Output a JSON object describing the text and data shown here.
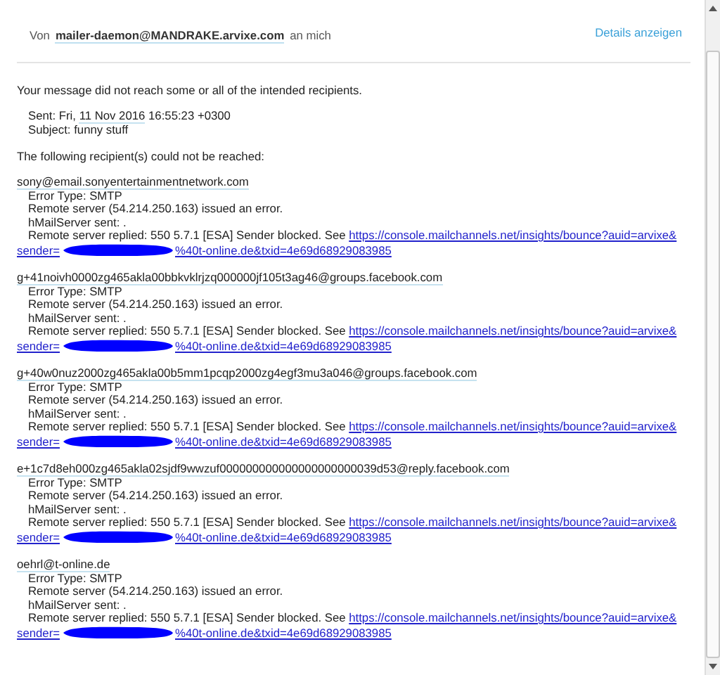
{
  "header": {
    "from_label": "Von",
    "sender": "mailer-daemon@MANDRAKE.arvixe.com",
    "to": "an mich",
    "details_link": "Details anzeigen"
  },
  "intro": "Your message did not reach some or all of the intended recipients.",
  "sent": {
    "label": "Sent: Fri,",
    "date": "11 Nov 2016",
    "time": "16:55:23 +0300"
  },
  "subject": "Subject: funny stuff",
  "failed_heading": "The following recipient(s) could not be reached:",
  "recipients": [
    {
      "address": "sony@email.sonyentertainmentnetwork.com",
      "error_type": "Error Type: SMTP",
      "remote_error": "Remote server (54.214.250.163) issued an error.",
      "hmail_sent": "hMailServer sent: .",
      "reply": "Remote server replied: 550 5.7.1 [ESA] Sender blocked. See",
      "link_start": "https://console.mailchannels.net/insights/bounce?auid=arvixe&",
      "link_prefix": "sender=",
      "link_end": "%40t-online.de&txid=4e69d68929083985"
    },
    {
      "address": "g+41noivh0000zg465akla00bbkvklrjzq000000jf105t3ag46@groups.facebook.com",
      "error_type": "Error Type: SMTP",
      "remote_error": "Remote server (54.214.250.163) issued an error.",
      "hmail_sent": "hMailServer sent: .",
      "reply": "Remote server replied: 550 5.7.1 [ESA] Sender blocked. See",
      "link_start": "https://console.mailchannels.net/insights/bounce?auid=arvixe&",
      "link_prefix": "sender=",
      "link_end": "%40t-online.de&txid=4e69d68929083985"
    },
    {
      "address": "g+40w0nuz2000zg465akla00b5mm1pcqp2000zg4egf3mu3a046@groups.facebook.com",
      "error_type": "Error Type: SMTP",
      "remote_error": "Remote server (54.214.250.163) issued an error.",
      "hmail_sent": "hMailServer sent: .",
      "reply": "Remote server replied: 550 5.7.1 [ESA] Sender blocked. See",
      "link_start": "https://console.mailchannels.net/insights/bounce?auid=arvixe&",
      "link_prefix": "sender=",
      "link_end": "%40t-online.de&txid=4e69d68929083985"
    },
    {
      "address": "e+1c7d8eh000zg465akla02sjdf9wwzuf000000000000000000000039d53@reply.facebook.com",
      "error_type": "Error Type: SMTP",
      "remote_error": "Remote server (54.214.250.163) issued an error.",
      "hmail_sent": "hMailServer sent: .",
      "reply": "Remote server replied: 550 5.7.1 [ESA] Sender blocked. See",
      "link_start": "https://console.mailchannels.net/insights/bounce?auid=arvixe&",
      "link_prefix": "sender=",
      "link_end": "%40t-online.de&txid=4e69d68929083985"
    },
    {
      "address": "oehrl@t-online.de",
      "error_type": "Error Type: SMTP",
      "remote_error": "Remote server (54.214.250.163) issued an error.",
      "hmail_sent": "hMailServer sent: .",
      "reply": "Remote server replied: 550 5.7.1 [ESA] Sender blocked. See",
      "link_start": "https://console.mailchannels.net/insights/bounce?auid=arvixe&",
      "link_prefix": "sender=",
      "link_end": "%40t-online.de&txid=4e69d68929083985"
    }
  ]
}
